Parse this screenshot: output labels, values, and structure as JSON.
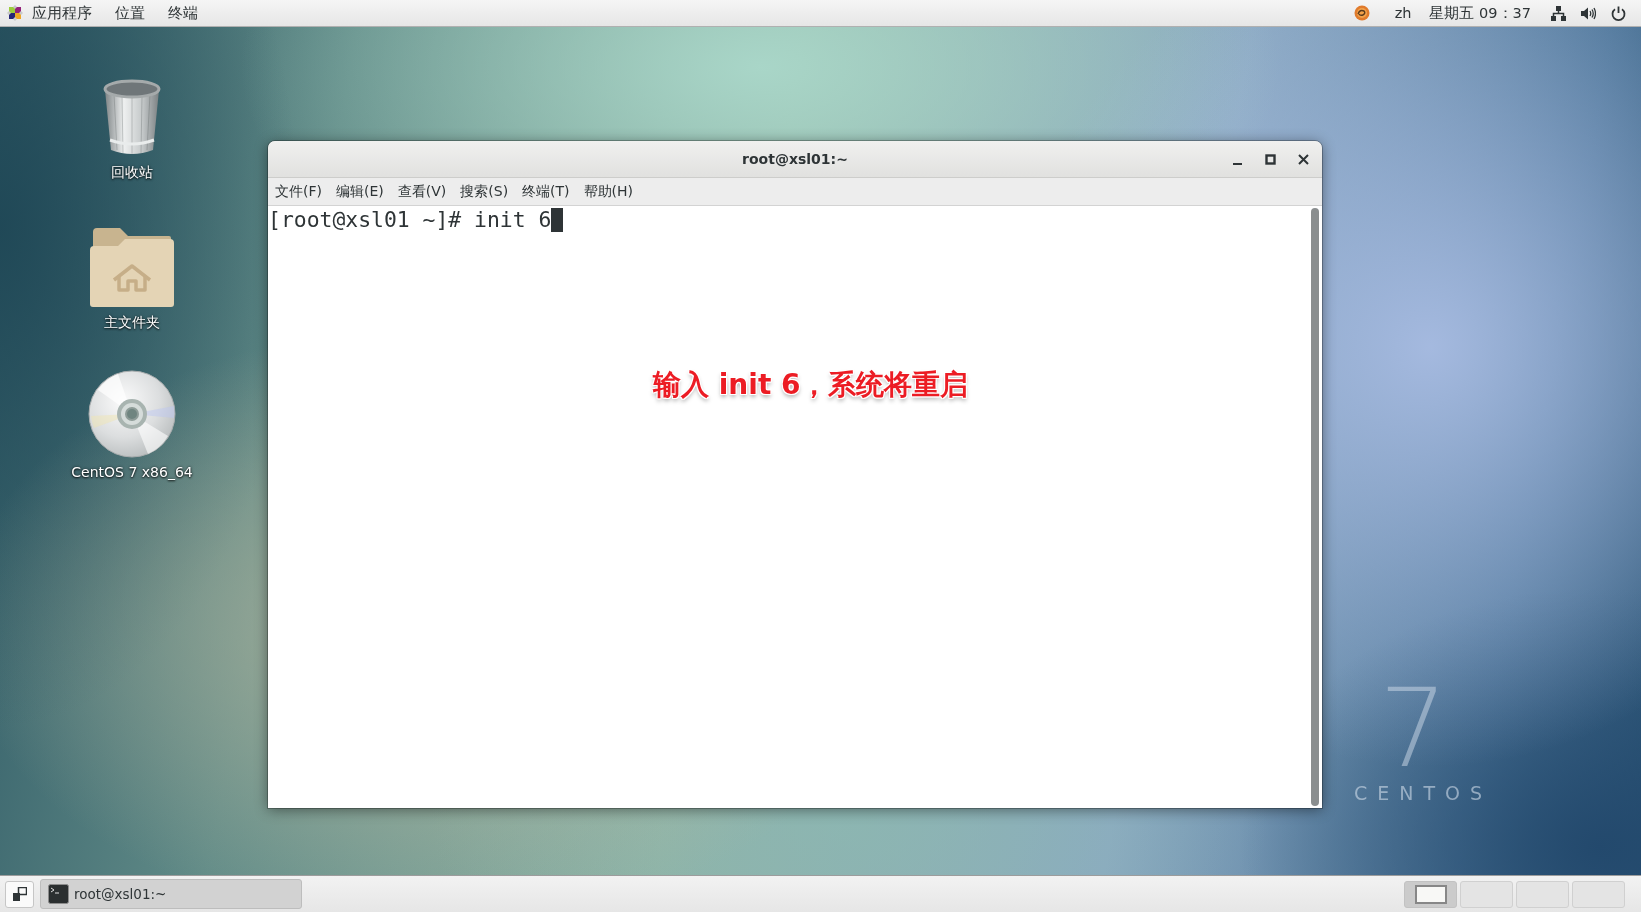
{
  "top_bar": {
    "menus": [
      "应用程序",
      "位置",
      "终端"
    ],
    "input_method": "zh",
    "clock": "星期五 09：37"
  },
  "desktop_icons": [
    {
      "kind": "trash",
      "label": "回收站"
    },
    {
      "kind": "folder",
      "label": "主文件夹"
    },
    {
      "kind": "disc",
      "label": "CentOS 7 x86_64"
    }
  ],
  "wallpaper_logo": {
    "numeral": "7",
    "wordmark": "CENTOS"
  },
  "terminal_window": {
    "title": "root@xsl01:~",
    "menus": [
      "文件(F)",
      "编辑(E)",
      "查看(V)",
      "搜索(S)",
      "终端(T)",
      "帮助(H)"
    ],
    "lines": [
      {
        "text": "[root@xsl01 ~]# init 6",
        "cursor": true
      }
    ],
    "annotation": "输入 init 6，系统将重启"
  },
  "taskbar": {
    "tasks": [
      {
        "title": "root@xsl01:~",
        "selected": true
      }
    ],
    "workspaces": [
      {
        "selected": true,
        "has_window": true
      },
      {
        "selected": false,
        "has_window": false
      },
      {
        "selected": false,
        "has_window": false
      },
      {
        "selected": false,
        "has_window": false
      }
    ]
  }
}
